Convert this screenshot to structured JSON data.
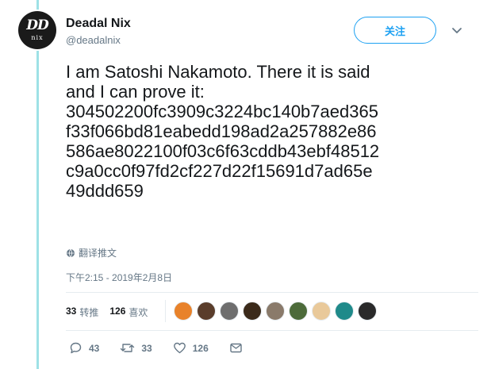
{
  "author": {
    "avatar_text": "DD",
    "avatar_sub": "nix",
    "name": "Deadal Nix",
    "handle": "@deadalnix"
  },
  "follow_label": "关注",
  "tweet": {
    "lines": [
      "I am Satoshi Nakamoto. There it is said",
      "and I can prove it:",
      "304502200fc3909c3224bc140b7aed365",
      "f33f066bd81eabedd198ad2a257882e86",
      "586ae8022100f03c6f63cddb43ebf48512",
      "c9a0cc0f97fd2cf227d22f15691d7ad65e",
      "49ddd659"
    ]
  },
  "translate_label": "翻译推文",
  "timestamp": "下午2:15 - 2019年2月8日",
  "stats": {
    "retweets_count": "33",
    "retweets_label": "转推",
    "likes_count": "126",
    "likes_label": "喜欢"
  },
  "likers": [
    {
      "name": "bitcoin-avatar-icon",
      "color": "#e8822a"
    },
    {
      "name": "person-avatar-icon",
      "color": "#5a3d2b"
    },
    {
      "name": "sketch-avatar-icon",
      "color": "#6e6e6e"
    },
    {
      "name": "portrait-avatar-icon",
      "color": "#3b2a1a"
    },
    {
      "name": "anime-avatar-icon",
      "color": "#8a7a6a"
    },
    {
      "name": "landscape-avatar-icon",
      "color": "#4d6b3a"
    },
    {
      "name": "cat-avatar-icon",
      "color": "#e9c99a"
    },
    {
      "name": "circuit-avatar-icon",
      "color": "#1f8a8a"
    },
    {
      "name": "dark-avatar-icon",
      "color": "#2a2a2a"
    }
  ],
  "actions": {
    "reply_count": "43",
    "retweet_count": "33",
    "like_count": "126"
  },
  "colors": {
    "accent": "#1da1f2",
    "thread": "#9ee1e6",
    "muted": "#657786"
  }
}
